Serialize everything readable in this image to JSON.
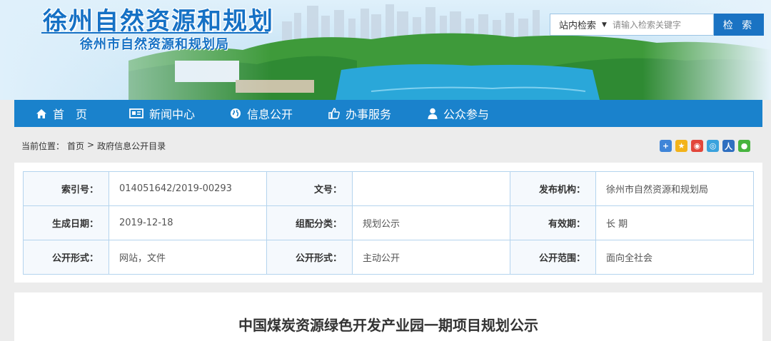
{
  "site": {
    "title": "徐州自然资源和规划",
    "subtitle": "徐州市自然资源和规划局"
  },
  "search": {
    "scope": "站内检索",
    "placeholder": "请输入检索关键字",
    "button": "检 索"
  },
  "nav": {
    "items": [
      {
        "label": "首　页",
        "icon": "home-icon"
      },
      {
        "label": "新闻中心",
        "icon": "news-icon"
      },
      {
        "label": "信息公开",
        "icon": "globe-icon"
      },
      {
        "label": "办事服务",
        "icon": "thumbs-up-icon"
      },
      {
        "label": "公众参与",
        "icon": "user-icon"
      }
    ]
  },
  "breadcrumb": {
    "prefix": "当前位置：",
    "home": "首页",
    "separator": ">",
    "current": "政府信息公开目录"
  },
  "share_icons": [
    "add-icon",
    "qzone-icon",
    "weibo-icon",
    "tencent-weibo-icon",
    "renren-icon",
    "wechat-icon"
  ],
  "info": {
    "rows": [
      [
        {
          "label": "索引号：",
          "value": "014051642/2019-00293"
        },
        {
          "label": "文号：",
          "value": ""
        },
        {
          "label": "发布机构：",
          "value": "徐州市自然资源和规划局"
        }
      ],
      [
        {
          "label": "生成日期：",
          "value": "2019-12-18"
        },
        {
          "label": "组配分类：",
          "value": "规划公示"
        },
        {
          "label": "有效期：",
          "value": "长 期"
        }
      ],
      [
        {
          "label": "公开形式：",
          "value": "网站，文件"
        },
        {
          "label": "公开形式：",
          "value": "主动公开"
        },
        {
          "label": "公开范围：",
          "value": "面向全社会"
        }
      ]
    ]
  },
  "article": {
    "title": "中国煤炭资源绿色开发产业园一期项目规划公示"
  },
  "colors": {
    "brand_blue": "#1671c5",
    "nav_blue": "#1a82cc",
    "table_border": "#b4d4ee"
  }
}
